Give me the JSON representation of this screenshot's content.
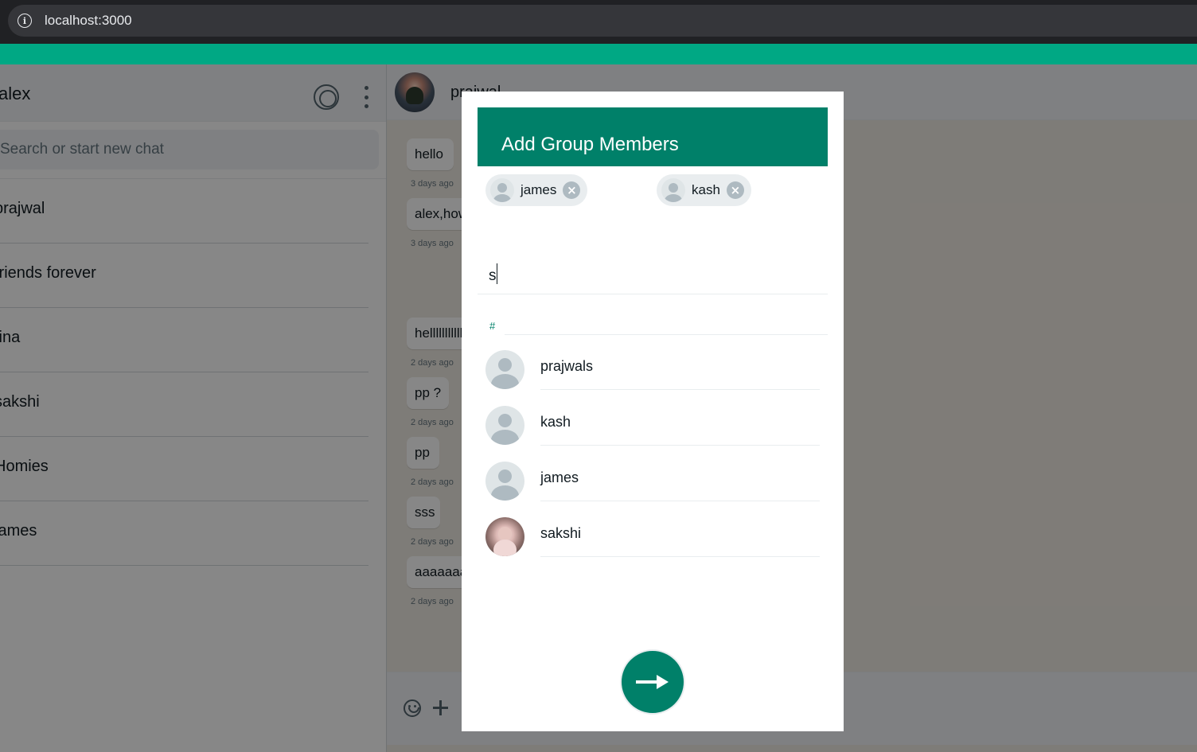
{
  "browser": {
    "url": "localhost:3000"
  },
  "sidebar": {
    "user_name": "alex",
    "search_placeholder": "Search or start new chat",
    "chats": [
      {
        "name": "prajwal"
      },
      {
        "name": "friends forever"
      },
      {
        "name": "tina"
      },
      {
        "name": "sakshi"
      },
      {
        "name": "Homies"
      },
      {
        "name": "james"
      }
    ]
  },
  "conversation": {
    "title": "prajwal",
    "messages": [
      {
        "text": "hello",
        "time": "3 days ago"
      },
      {
        "text": "alex,how are you",
        "time": "3 days ago"
      },
      {
        "text": "helllllllllll",
        "time": "2 days ago"
      },
      {
        "text": "pp ?",
        "time": "2 days ago"
      },
      {
        "text": "pp",
        "time": "2 days ago"
      },
      {
        "text": "sss",
        "time": "2 days ago"
      },
      {
        "text": "aaaaaaa",
        "time": "2 days ago"
      }
    ]
  },
  "modal": {
    "title": "Add Group Members",
    "selected": [
      {
        "name": "james"
      },
      {
        "name": "kash"
      }
    ],
    "search_value": "s",
    "section_label": "#",
    "contacts": [
      {
        "name": "prajwals",
        "avatar": "default"
      },
      {
        "name": "kash",
        "avatar": "default"
      },
      {
        "name": "james",
        "avatar": "default"
      },
      {
        "name": "sakshi",
        "avatar": "photo"
      }
    ],
    "next_icon": "arrow-right-icon"
  },
  "colors": {
    "accent": "#008069",
    "accent_light": "#00a884",
    "overlay": "rgba(0,0,0,0.47)"
  }
}
